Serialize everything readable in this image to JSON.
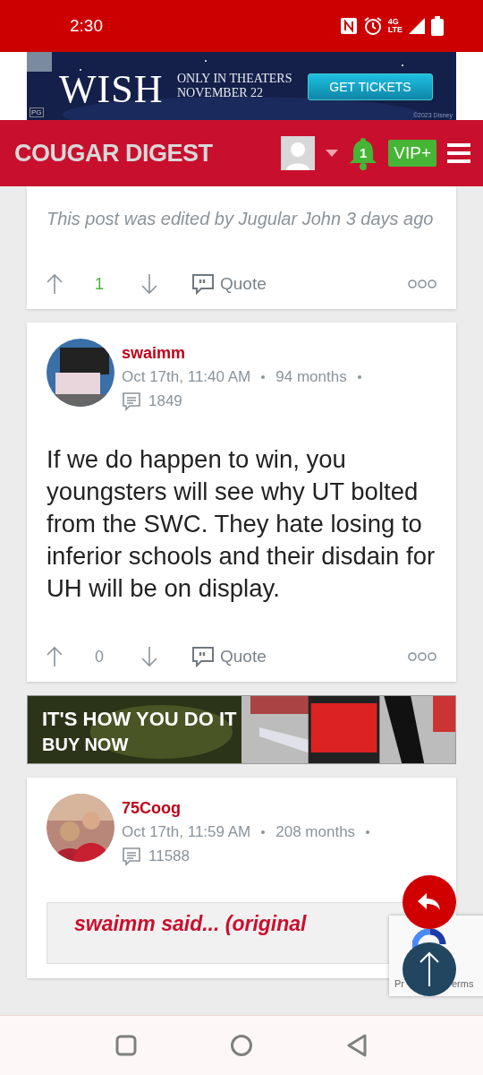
{
  "status_bar": {
    "time": "2:30",
    "network": [
      "4G",
      "LTE"
    ]
  },
  "top_ad": {
    "title": "WISH",
    "lines": [
      "ONLY IN THEATERS",
      "NOVEMBER 22"
    ],
    "button": "GET TICKETS",
    "rating": "PG",
    "copyright": "©2023 Disney"
  },
  "header": {
    "logo": "COUGAR DIGEST",
    "notifications": "1",
    "vip": "VIP+"
  },
  "posts": [
    {
      "edit_note": "This post was edited by Jugular John 3 days ago",
      "score": "1",
      "score_positive": true,
      "quote_label": "Quote"
    },
    {
      "author": "swaimm",
      "date": "Oct 17th, 11:40 AM",
      "tenure": "94 months",
      "post_count": "1849",
      "body": "If we do happen to win, you youngsters will see why UT bolted from the SWC. They hate losing to inferior schools and their disdain for UH will be on display.",
      "score": "0",
      "score_positive": false,
      "quote_label": "Quote"
    },
    {
      "author": "75Coog",
      "date": "Oct 17th, 11:59 AM",
      "tenure": "208 months",
      "post_count": "11588",
      "quote_heading": "swaimm said... (original"
    }
  ],
  "mid_ad": {
    "lines": [
      "IT'S HOW YOU DO IT",
      "BUY NOW"
    ]
  },
  "recaptcha": {
    "visible_text": [
      "Pr",
      "erms"
    ]
  }
}
